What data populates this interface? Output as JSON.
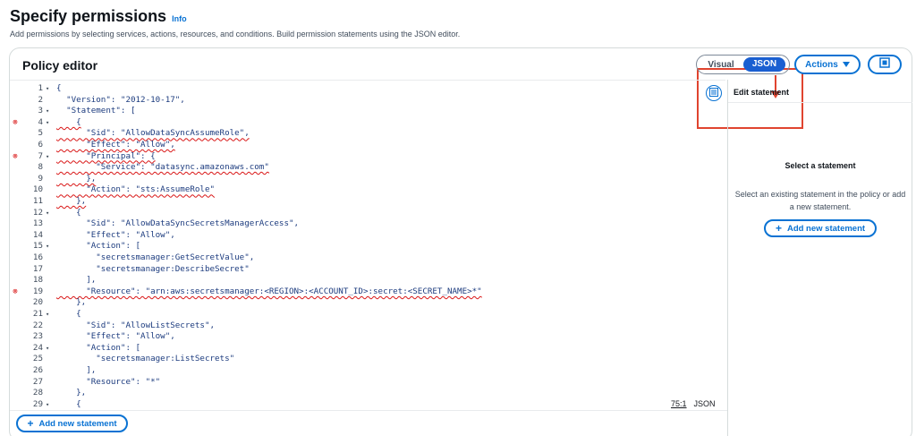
{
  "header": {
    "title": "Specify permissions",
    "info": "Info",
    "subtitle": "Add permissions by selecting services, actions, resources, and conditions. Build permission statements using the JSON editor."
  },
  "policy_editor": {
    "title": "Policy editor",
    "toggle_visual": "Visual",
    "toggle_json": "JSON",
    "toggle_selected": "JSON",
    "actions_label": "Actions",
    "status_position": "75:1",
    "status_mode": "JSON",
    "add_statement": "Add new statement"
  },
  "side_panel": {
    "title": "Edit statement",
    "select_title": "Select a statement",
    "select_desc": "Select an existing statement in the policy or add a new statement.",
    "add_statement": "Add new statement"
  },
  "code_lines": [
    {
      "n": "1",
      "t": "{",
      "fold": true,
      "err": false
    },
    {
      "n": "2",
      "t": "  \"Version\": \"2012-10-17\",",
      "fold": false,
      "err": false
    },
    {
      "n": "3",
      "t": "  \"Statement\": [",
      "fold": true,
      "err": false
    },
    {
      "n": "4",
      "t": "    {",
      "fold": true,
      "err": true
    },
    {
      "n": "5",
      "t": "      \"Sid\": \"AllowDataSyncAssumeRole\",",
      "fold": false,
      "err": false
    },
    {
      "n": "6",
      "t": "      \"Effect\": \"Allow\",",
      "fold": false,
      "err": false
    },
    {
      "n": "7",
      "t": "      \"Principal\": {",
      "fold": true,
      "err": true
    },
    {
      "n": "8",
      "t": "        \"Service\": \"datasync.amazonaws.com\"",
      "fold": false,
      "err": false
    },
    {
      "n": "9",
      "t": "      },",
      "fold": false,
      "err": false
    },
    {
      "n": "10",
      "t": "      \"Action\": \"sts:AssumeRole\"",
      "fold": false,
      "err": false
    },
    {
      "n": "11",
      "t": "    },",
      "fold": false,
      "err": false
    },
    {
      "n": "12",
      "t": "    {",
      "fold": true,
      "err": false
    },
    {
      "n": "13",
      "t": "      \"Sid\": \"AllowDataSyncSecretsManagerAccess\",",
      "fold": false,
      "err": false
    },
    {
      "n": "14",
      "t": "      \"Effect\": \"Allow\",",
      "fold": false,
      "err": false
    },
    {
      "n": "15",
      "t": "      \"Action\": [",
      "fold": true,
      "err": false
    },
    {
      "n": "16",
      "t": "        \"secretsmanager:GetSecretValue\",",
      "fold": false,
      "err": false
    },
    {
      "n": "17",
      "t": "        \"secretsmanager:DescribeSecret\"",
      "fold": false,
      "err": false
    },
    {
      "n": "18",
      "t": "      ],",
      "fold": false,
      "err": false
    },
    {
      "n": "19",
      "t": "      \"Resource\": \"arn:aws:secretsmanager:<REGION>:<ACCOUNT_ID>:secret:<SECRET_NAME>*\"",
      "fold": false,
      "err": true
    },
    {
      "n": "20",
      "t": "    },",
      "fold": false,
      "err": false
    },
    {
      "n": "21",
      "t": "    {",
      "fold": true,
      "err": false
    },
    {
      "n": "22",
      "t": "      \"Sid\": \"AllowListSecrets\",",
      "fold": false,
      "err": false
    },
    {
      "n": "23",
      "t": "      \"Effect\": \"Allow\",",
      "fold": false,
      "err": false
    },
    {
      "n": "24",
      "t": "      \"Action\": [",
      "fold": true,
      "err": false
    },
    {
      "n": "25",
      "t": "        \"secretsmanager:ListSecrets\"",
      "fold": false,
      "err": false
    },
    {
      "n": "26",
      "t": "      ],",
      "fold": false,
      "err": false
    },
    {
      "n": "27",
      "t": "      \"Resource\": \"*\"",
      "fold": false,
      "err": false
    },
    {
      "n": "28",
      "t": "    },",
      "fold": false,
      "err": false
    },
    {
      "n": "29",
      "t": "    {",
      "fold": true,
      "err": false
    }
  ],
  "squiggle_lines": [
    "4",
    "5",
    "6",
    "7",
    "8",
    "9",
    "10",
    "11",
    "19"
  ],
  "icons": {
    "error": "error-circle-icon",
    "fold": "fold-caret-icon",
    "format": "format-icon",
    "fullscreen": "fullscreen-icon",
    "dropdown": "caret-down-icon",
    "add": "plus-icon"
  },
  "colors": {
    "accent": "#0972d3",
    "toggle_active": "#1a5fd1",
    "error": "#d91515",
    "annotation": "#e0442f"
  }
}
